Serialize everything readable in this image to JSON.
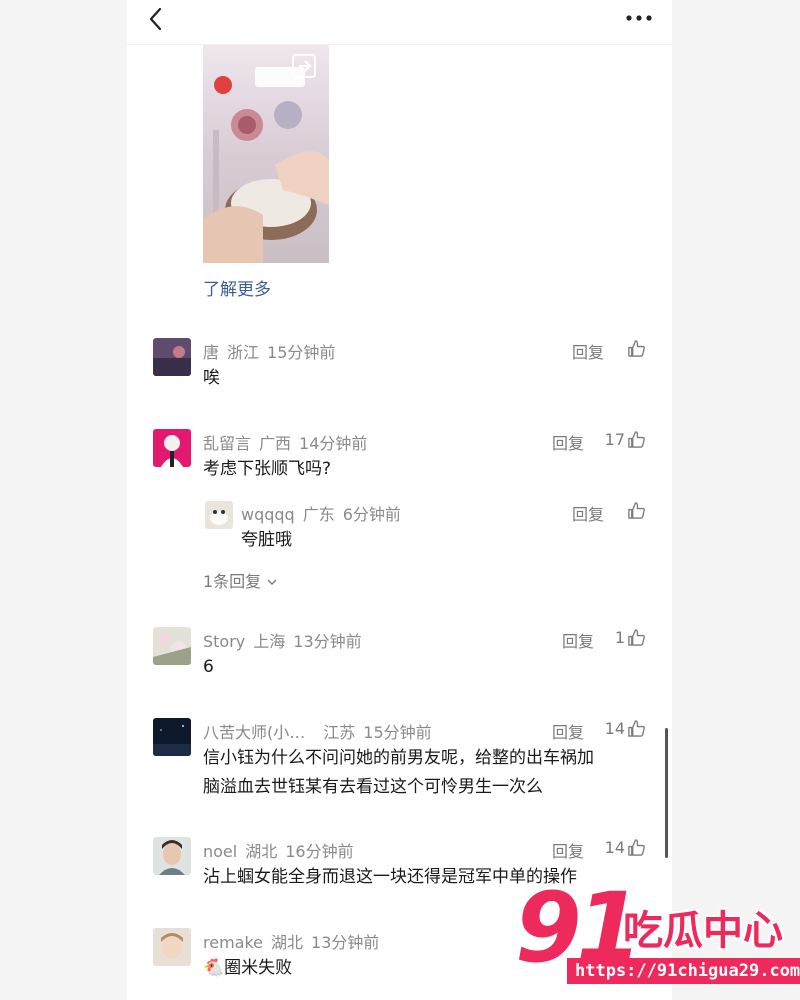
{
  "post": {
    "learn_more": "了解更多"
  },
  "comments": [
    {
      "user": "唐",
      "region": "浙江",
      "time": "15分钟前",
      "text": "唉",
      "reply": "回复",
      "likes": ""
    },
    {
      "user": "乱留言",
      "region": "广西",
      "time": "14分钟前",
      "text": "考虑下张顺飞吗?",
      "reply": "回复",
      "likes": "17",
      "sub_reply": {
        "user": "wqqqq",
        "region": "广东",
        "time": "6分钟前",
        "text": "夸脏哦",
        "reply": "回复",
        "likes": ""
      },
      "more_replies": "1条回复"
    },
    {
      "user": "Story",
      "region": "上海",
      "time": "13分钟前",
      "text": "6",
      "reply": "回复",
      "likes": "1"
    },
    {
      "user": "八苦大师(小…",
      "region": "江苏",
      "time": "15分钟前",
      "text_line1": "信小钰为什么不问问她的前男友呢，给整的出车祸加",
      "text_line2": "脑溢血去世钰某有去看过这个可怜男生一次么",
      "reply": "回复",
      "likes": "14"
    },
    {
      "user": "noel",
      "region": "湖北",
      "time": "16分钟前",
      "text": "沾上蝈女能全身而退这一块还得是冠军中单的操作",
      "reply": "回复",
      "likes": "14"
    },
    {
      "user": "remake",
      "region": "湖北",
      "time": "13分钟前",
      "text": "圈米失败",
      "emoji": "🐔"
    }
  ],
  "watermark": {
    "logo_number": "91",
    "logo_text": "吃瓜中心",
    "url": "https://91chigua29.com"
  },
  "colors": {
    "link": "#3d5d96",
    "meta": "#8a8a8a",
    "brand": "#ee2a5c"
  }
}
